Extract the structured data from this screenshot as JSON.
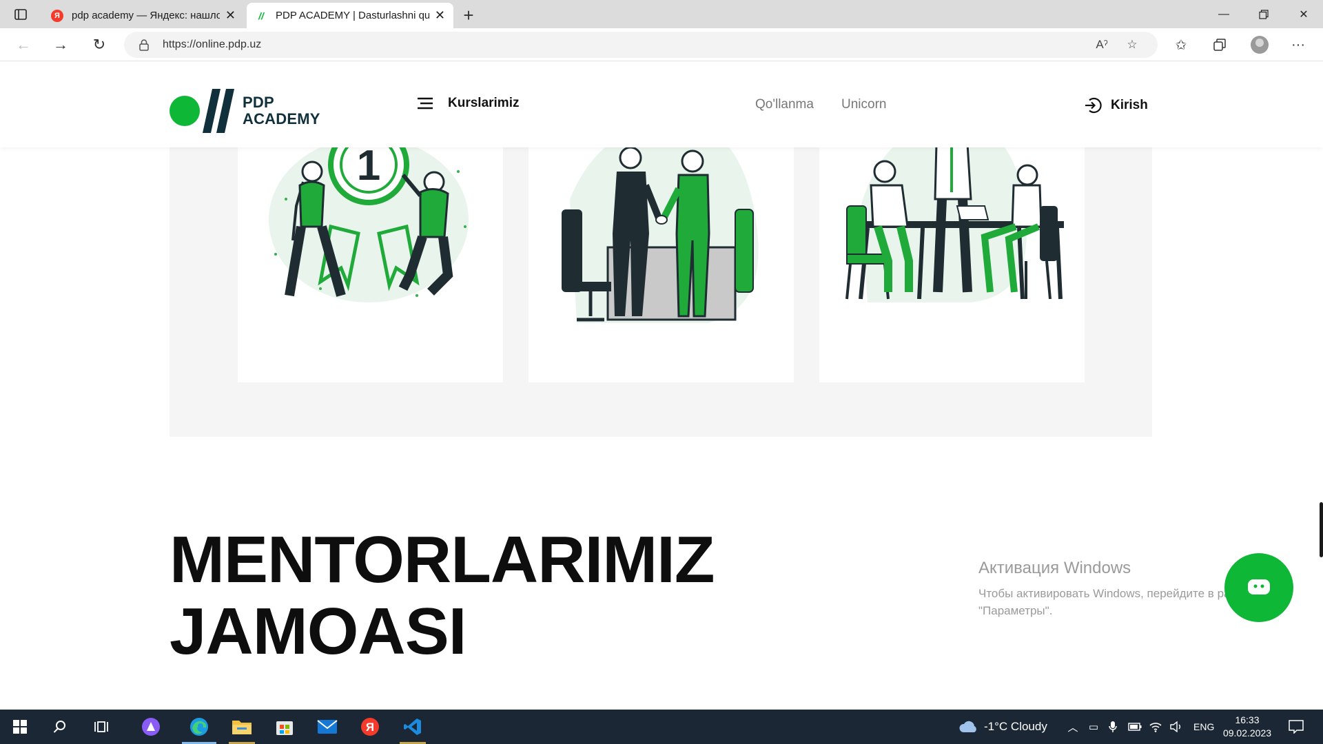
{
  "browser": {
    "tabs": [
      {
        "title": "pdp academy — Яндекс: нашлось",
        "favicon_letter": "Я",
        "favicon_color": "#f33a2b",
        "active": false
      },
      {
        "title": "PDP ACADEMY | Dasturlashni qulay",
        "favicon_letter": "//",
        "favicon_color": "#0fb736",
        "active": true
      }
    ],
    "url": "https://online.pdp.uz"
  },
  "site": {
    "logo_line1": "PDP",
    "logo_line2": "ACADEMY",
    "menu_label": "Kurslarimiz",
    "nav_links": [
      "Qo'llanma",
      "Unicorn"
    ],
    "login_label": "Kirish",
    "accent_color": "#0fb736",
    "dark_color": "#10303c"
  },
  "cards": [
    {
      "illustration": "winners-with-award-ribbon"
    },
    {
      "illustration": "business-handshake"
    },
    {
      "illustration": "team-meeting-at-table"
    }
  ],
  "section": {
    "title_line1": "MENTORLARIMIZ",
    "title_line2": "JAMOASI"
  },
  "windows_activation": {
    "heading": "Активация Windows",
    "line1": "Чтобы активировать Windows, перейдите в раздел",
    "line2": "\"Параметры\"."
  },
  "taskbar": {
    "apps": [
      "start",
      "search",
      "task-view",
      "alice",
      "edge",
      "file-explorer",
      "microsoft-store",
      "mail",
      "yandex-browser",
      "vscode"
    ],
    "weather": "-1°C  Cloudy",
    "language": "ENG",
    "time": "16:33",
    "date": "09.02.2023"
  }
}
